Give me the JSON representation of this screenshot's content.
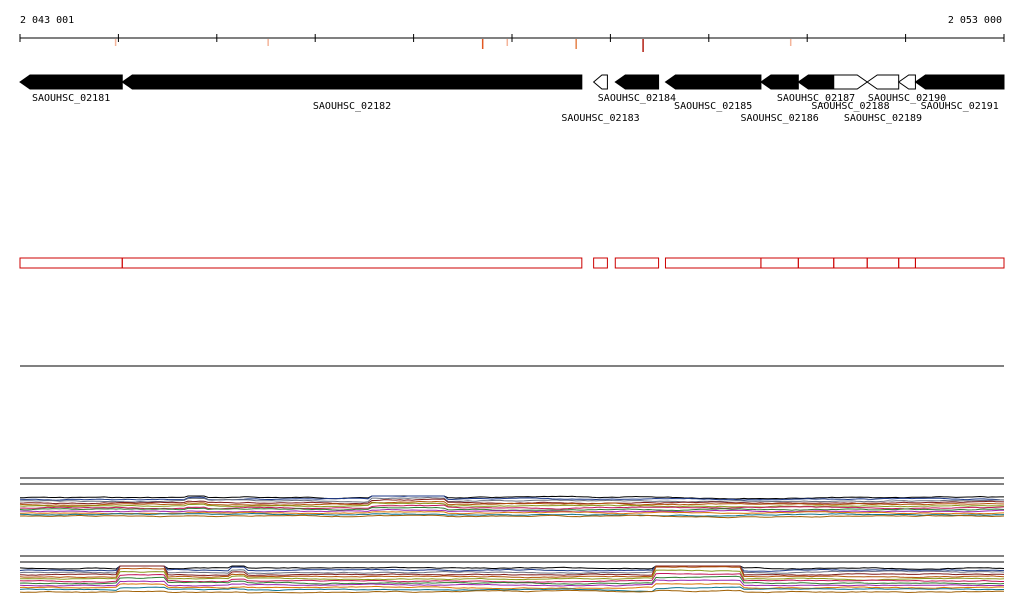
{
  "coordinates": {
    "start_label": "2 043 001",
    "end_label": "2 053 000"
  },
  "genes": [
    {
      "label": "SAOUHSC_02181",
      "start": 2043001,
      "end": 2044040,
      "strand": "-",
      "fill": "black",
      "label_row": 1
    },
    {
      "label": "SAOUHSC_02182",
      "start": 2044040,
      "end": 2048710,
      "strand": "-",
      "fill": "black",
      "label_row": 2
    },
    {
      "label": "SAOUHSC_02183",
      "start": 2048830,
      "end": 2048970,
      "strand": "-",
      "fill": "white",
      "label_row": 3
    },
    {
      "label": "SAOUHSC_02184",
      "start": 2049050,
      "end": 2049490,
      "strand": "-",
      "fill": "black",
      "label_row": 1
    },
    {
      "label": "SAOUHSC_02185",
      "start": 2049560,
      "end": 2050530,
      "strand": "-",
      "fill": "black",
      "label_row": 2
    },
    {
      "label": "SAOUHSC_02186",
      "start": 2050530,
      "end": 2050910,
      "strand": "-",
      "fill": "black",
      "label_row": 3
    },
    {
      "label": "SAOUHSC_02187",
      "start": 2050910,
      "end": 2051270,
      "strand": "-",
      "fill": "black",
      "label_row": 1
    },
    {
      "label": "SAOUHSC_02188",
      "start": 2051270,
      "end": 2051610,
      "strand": "+",
      "fill": "white",
      "label_row": 2
    },
    {
      "label": "SAOUHSC_02189",
      "start": 2051610,
      "end": 2051930,
      "strand": "-",
      "fill": "white",
      "label_row": 3
    },
    {
      "label": "SAOUHSC_02190",
      "start": 2051930,
      "end": 2052100,
      "strand": "-",
      "fill": "white",
      "label_row": 1
    },
    {
      "label": "SAOUHSC_02191",
      "start": 2052100,
      "end": 2053000,
      "strand": "-",
      "fill": "black",
      "label_row": 2
    }
  ],
  "ruler_marks": [
    {
      "position": 2043970,
      "color": "#f4b49a",
      "depth": 1
    },
    {
      "position": 2045520,
      "color": "#f4b49a",
      "depth": 1
    },
    {
      "position": 2047700,
      "color": "#e25822",
      "depth": 2
    },
    {
      "position": 2047950,
      "color": "#f4b49a",
      "depth": 1
    },
    {
      "position": 2048650,
      "color": "#e5824a",
      "depth": 2
    },
    {
      "position": 2049330,
      "color": "#b21e12",
      "depth": 3
    },
    {
      "position": 2050830,
      "color": "#f4b49a",
      "depth": 1
    }
  ],
  "feature_boxes": [
    {
      "start": 2043001,
      "end": 2044040
    },
    {
      "start": 2044040,
      "end": 2048710
    },
    {
      "start": 2048830,
      "end": 2048970
    },
    {
      "start": 2049050,
      "end": 2049490
    },
    {
      "start": 2049560,
      "end": 2050530
    },
    {
      "start": 2050530,
      "end": 2050910
    },
    {
      "start": 2050910,
      "end": 2051270
    },
    {
      "start": 2051270,
      "end": 2051610
    },
    {
      "start": 2051610,
      "end": 2051930
    },
    {
      "start": 2051930,
      "end": 2052100
    },
    {
      "start": 2052100,
      "end": 2053000
    }
  ],
  "expression_tracks": {
    "series_colors": [
      "#000000",
      "#1e3a8a",
      "#6b7280",
      "#7f1d1d",
      "#b45309",
      "#8a9a1b",
      "#c2185b",
      "#2e7d32",
      "#9c27b0",
      "#d97706",
      "#0e7490",
      "#a16207"
    ]
  }
}
